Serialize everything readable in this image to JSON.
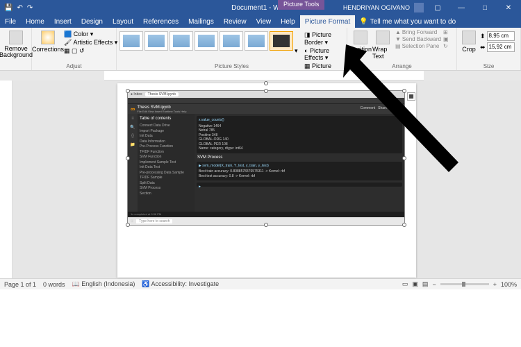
{
  "titlebar": {
    "doc_title": "Document1 - Word",
    "context_tool": "Picture Tools",
    "username": "HENDRIYAN OGIVANO"
  },
  "menu": {
    "tabs": [
      "File",
      "Home",
      "Insert",
      "Design",
      "Layout",
      "References",
      "Mailings",
      "Review",
      "View",
      "Help",
      "Picture Format"
    ],
    "active": "Picture Format",
    "tell_me": "Tell me what you want to do"
  },
  "ribbon": {
    "remove_bg": "Remove Background",
    "corrections": "Corrections",
    "color": "Color",
    "artistic": "Artistic Effects",
    "adjust_label": "Adjust",
    "styles_label": "Picture Styles",
    "pic_border": "Picture Border",
    "pic_effects": "Picture Effects",
    "pic_layout": "Picture Layout",
    "position": "Position",
    "wrap_text": "Wrap Text",
    "bring_fwd": "Bring Forward",
    "send_back": "Send Backward",
    "sel_pane": "Selection Pane",
    "align": "Align",
    "group": "Group",
    "rotate": "Rotate",
    "arrange_label": "Arrange",
    "crop": "Crop",
    "height": "8,95 cm",
    "width": "15,92 cm",
    "size_label": "Size"
  },
  "colab": {
    "tab1": "Thesis SVM.ipynb",
    "file_title": "Thesis SVM.ipynb",
    "menus": "File  Edit  View  Insert  Runtime  Tools  Help",
    "toc_title": "Table of contents",
    "toc": [
      "Connect Data Drive",
      "Import Package",
      "Init Data",
      "Data Information",
      "Pre-Process Function",
      "TFIDF Function",
      "SVM Function",
      "Implement Sample Test",
      "  Init Data Test",
      "  Pre-processing Data Sample",
      "  TFIDF Sample",
      "  Split Data",
      "  SVM Process",
      "Section"
    ],
    "code_top": "x.value_counts()",
    "output_lines": [
      "Negative   1464",
      "Netral      785",
      "Positive    348",
      "GLOBAL-ORG  140",
      "GLOBAL-PER  108",
      "Name: category, dtype: int64"
    ],
    "svm_header": "SVM Process",
    "svm_call": "svm_model(X_train, Y_test, y_train, y_test)",
    "svm_out1": "Best train accuracy: 0.8088578376575311 -> Kernel: rbf",
    "svm_out2": "Best test accuracy: 0.8 -> Kernel: rbf",
    "status": "1s   completed at 9:36 PM",
    "comment": "Comment",
    "share": "Share"
  },
  "taskbar": {
    "search": "Type here to search"
  },
  "statusbar": {
    "page": "Page 1 of 1",
    "words": "0 words",
    "lang": "English (Indonesia)",
    "access": "Accessibility: Investigate",
    "zoom": "100%"
  }
}
